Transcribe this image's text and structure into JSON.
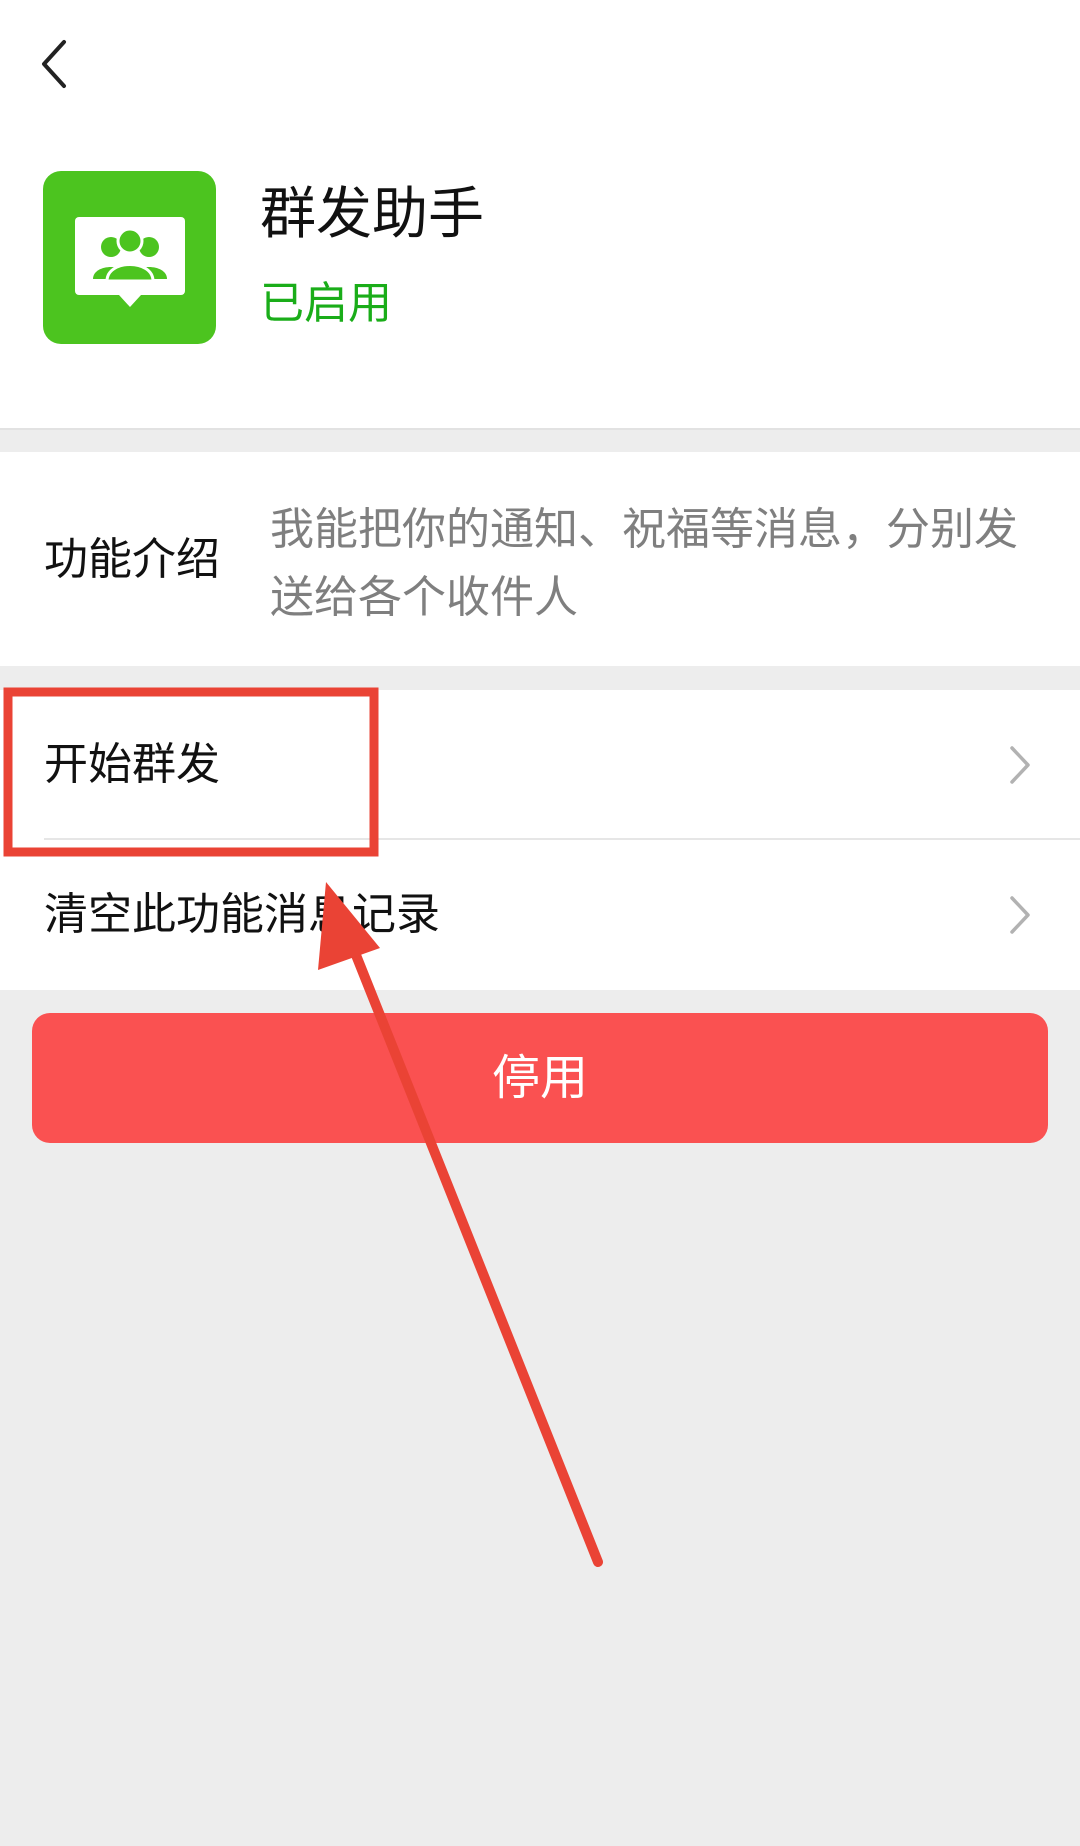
{
  "header": {
    "back_icon": "chevron-left-icon",
    "app_icon": "group-chat-icon",
    "app_name": "群发助手",
    "status": "已启用"
  },
  "intro": {
    "label": "功能介绍",
    "description": "我能把你的通知、祝福等消息，分别发送给各个收件人"
  },
  "menu": {
    "items": [
      {
        "label": "开始群发",
        "icon": "chevron-right-icon"
      },
      {
        "label": "清空此功能消息记录",
        "icon": "chevron-right-icon"
      }
    ]
  },
  "stop_button": {
    "label": "停用"
  },
  "colors": {
    "accent_green": "#1aad19",
    "icon_green": "#4cc41f",
    "danger": "#fa5151",
    "annotation_red": "#ea4335",
    "background": "#ededed"
  }
}
